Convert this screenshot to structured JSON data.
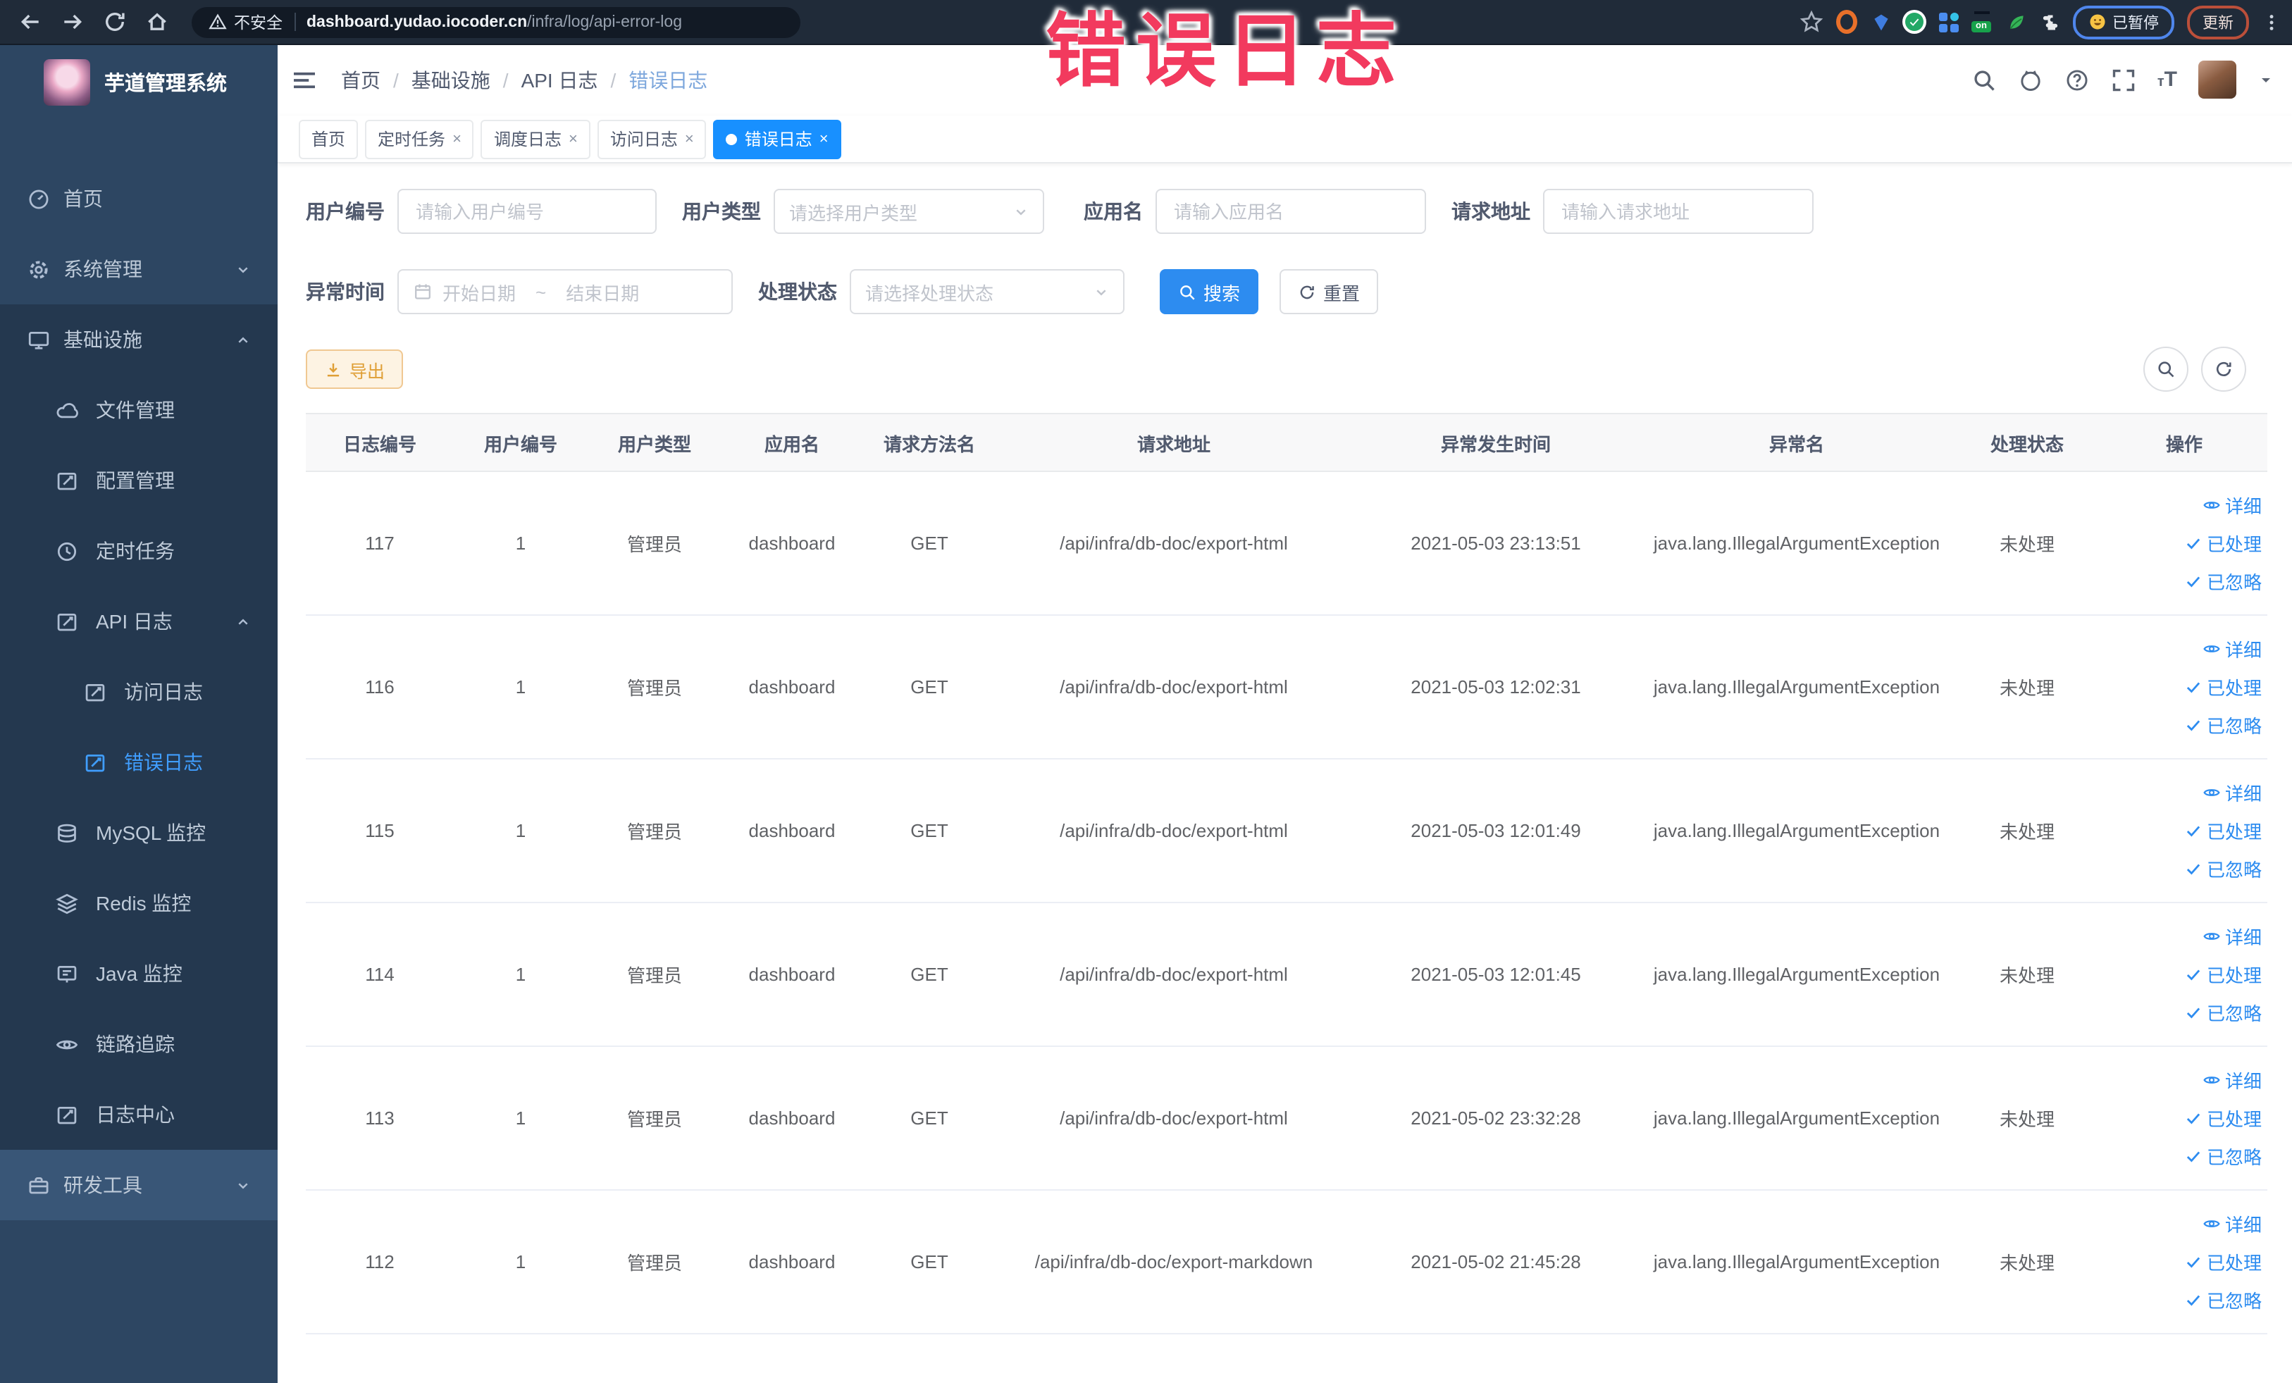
{
  "annotation": {
    "text": "错误日志"
  },
  "browser": {
    "security_label": "不安全",
    "url_host": "dashboard.yudao.iocoder.cn",
    "url_path": "/infra/log/api-error-log",
    "on_badge": "on",
    "paused_button": "已暂停",
    "update_button": "更新"
  },
  "sidebar": {
    "logo_title": "芋道管理系统",
    "items": [
      {
        "label": "首页"
      },
      {
        "label": "系统管理"
      },
      {
        "label": "基础设施"
      },
      {
        "label": "文件管理"
      },
      {
        "label": "配置管理"
      },
      {
        "label": "定时任务"
      },
      {
        "label": "API 日志"
      },
      {
        "label": "访问日志"
      },
      {
        "label": "错误日志"
      },
      {
        "label": "MySQL 监控"
      },
      {
        "label": "Redis 监控"
      },
      {
        "label": "Java 监控"
      },
      {
        "label": "链路追踪"
      },
      {
        "label": "日志中心"
      },
      {
        "label": "研发工具"
      }
    ]
  },
  "header": {
    "breadcrumb": [
      "首页",
      "基础设施",
      "API 日志",
      "错误日志"
    ]
  },
  "tabs": [
    {
      "label": "首页"
    },
    {
      "label": "定时任务"
    },
    {
      "label": "调度日志"
    },
    {
      "label": "访问日志"
    },
    {
      "label": "错误日志"
    }
  ],
  "filters": {
    "user_id": {
      "label": "用户编号",
      "placeholder": "请输入用户编号"
    },
    "user_type": {
      "label": "用户类型",
      "placeholder": "请选择用户类型"
    },
    "app_name": {
      "label": "应用名",
      "placeholder": "请输入应用名"
    },
    "request_url": {
      "label": "请求地址",
      "placeholder": "请输入请求地址"
    },
    "exception_time": {
      "label": "异常时间",
      "start_placeholder": "开始日期",
      "separator": "~",
      "end_placeholder": "结束日期"
    },
    "process_status": {
      "label": "处理状态",
      "placeholder": "请选择处理状态"
    },
    "search_button": "搜索",
    "reset_button": "重置"
  },
  "toolbar": {
    "export_button": "导出"
  },
  "table": {
    "columns": [
      "日志编号",
      "用户编号",
      "用户类型",
      "应用名",
      "请求方法名",
      "请求地址",
      "异常发生时间",
      "异常名",
      "处理状态",
      "操作"
    ],
    "row_actions": [
      "详细",
      "已处理",
      "已忽略"
    ],
    "rows": [
      {
        "id": "117",
        "user_id": "1",
        "user_type": "管理员",
        "app": "dashboard",
        "method": "GET",
        "url": "/api/infra/db-doc/export-html",
        "time": "2021-05-03 23:13:51",
        "exception": "java.lang.IllegalArgumentException",
        "status": "未处理"
      },
      {
        "id": "116",
        "user_id": "1",
        "user_type": "管理员",
        "app": "dashboard",
        "method": "GET",
        "url": "/api/infra/db-doc/export-html",
        "time": "2021-05-03 12:02:31",
        "exception": "java.lang.IllegalArgumentException",
        "status": "未处理"
      },
      {
        "id": "115",
        "user_id": "1",
        "user_type": "管理员",
        "app": "dashboard",
        "method": "GET",
        "url": "/api/infra/db-doc/export-html",
        "time": "2021-05-03 12:01:49",
        "exception": "java.lang.IllegalArgumentException",
        "status": "未处理"
      },
      {
        "id": "114",
        "user_id": "1",
        "user_type": "管理员",
        "app": "dashboard",
        "method": "GET",
        "url": "/api/infra/db-doc/export-html",
        "time": "2021-05-03 12:01:45",
        "exception": "java.lang.IllegalArgumentException",
        "status": "未处理"
      },
      {
        "id": "113",
        "user_id": "1",
        "user_type": "管理员",
        "app": "dashboard",
        "method": "GET",
        "url": "/api/infra/db-doc/export-html",
        "time": "2021-05-02 23:32:28",
        "exception": "java.lang.IllegalArgumentException",
        "status": "未处理"
      },
      {
        "id": "112",
        "user_id": "1",
        "user_type": "管理员",
        "app": "dashboard",
        "method": "GET",
        "url": "/api/infra/db-doc/export-markdown",
        "time": "2021-05-02 21:45:28",
        "exception": "java.lang.IllegalArgumentException",
        "status": "未处理"
      }
    ]
  },
  "colors": {
    "primary": "#1890ff",
    "link": "#2d8cf0",
    "warning": "#e6a23c",
    "annotation": "#f23a5e",
    "sidebar_bg": "#2d4662",
    "sidebar_submenu_bg": "#24384f",
    "browser_bar_bg": "#202b39"
  }
}
